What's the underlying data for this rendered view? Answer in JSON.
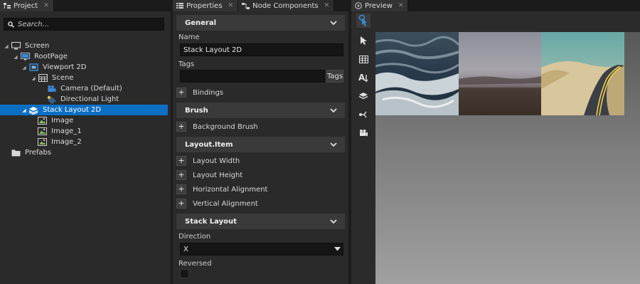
{
  "project": {
    "tab_label": "Project",
    "search_placeholder": "Search...",
    "tree": [
      {
        "label": "Screen",
        "icon": "screen-icon"
      },
      {
        "label": "RootPage",
        "icon": "page-icon"
      },
      {
        "label": "Viewport 2D",
        "icon": "viewport-icon"
      },
      {
        "label": "Scene",
        "icon": "scene-icon"
      },
      {
        "label": "Camera (Default)",
        "icon": "camera-icon"
      },
      {
        "label": "Directional Light",
        "icon": "light-icon"
      },
      {
        "label": "Stack Layout 2D",
        "icon": "stack-layout-icon",
        "selected": true
      },
      {
        "label": "Image",
        "icon": "image-icon"
      },
      {
        "label": "Image_1",
        "icon": "image-icon"
      },
      {
        "label": "Image_2",
        "icon": "image-icon"
      },
      {
        "label": "Prefabs",
        "icon": "folder-icon"
      }
    ]
  },
  "properties": {
    "tab_properties": "Properties",
    "tab_node_components": "Node Components",
    "general": {
      "header": "General",
      "name_label": "Name",
      "name_value": "Stack Layout 2D",
      "tags_label": "Tags",
      "tags_value": "",
      "tags_button": "Tags",
      "bindings": "Bindings"
    },
    "brush": {
      "header": "Brush",
      "background_brush": "Background Brush"
    },
    "layout_item": {
      "header": "Layout.Item",
      "rows": [
        "Layout Width",
        "Layout Height",
        "Horizontal Alignment",
        "Vertical Alignment"
      ]
    },
    "stack_layout": {
      "header": "Stack Layout",
      "direction_label": "Direction",
      "direction_value": "X",
      "reversed_label": "Reversed",
      "reversed_checked": false
    }
  },
  "preview": {
    "tab_label": "Preview",
    "tools": [
      "interact-tool-icon",
      "select-tool-icon",
      "grid-tool-icon",
      "text-tool-icon",
      "layers-tool-icon",
      "connector-tool-icon",
      "camera-tool-icon"
    ],
    "images": [
      "ocean-waves-image",
      "misty-field-image",
      "desert-road-image"
    ]
  },
  "colors": {
    "selection": "#0b6fc4",
    "accent_icon": "#3b8ad8",
    "panel_bg": "#2a2a2a"
  }
}
